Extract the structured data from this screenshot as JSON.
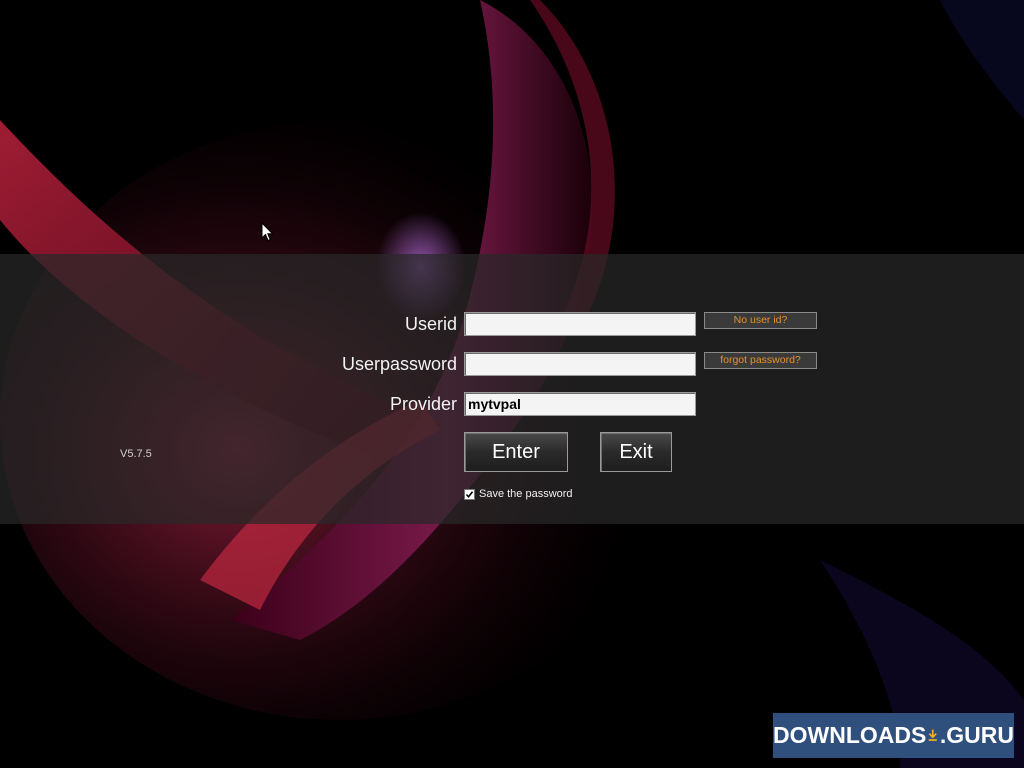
{
  "form": {
    "userid_label": "Userid",
    "userid_value": "",
    "password_label": "Userpassword",
    "password_value": "",
    "provider_label": "Provider",
    "provider_value": "mytvpal",
    "no_user_id_link": "No user id?",
    "forgot_password_link": "forgot password?",
    "enter_label": "Enter",
    "exit_label": "Exit",
    "save_password_label": "Save the password",
    "save_password_checked": true
  },
  "version": "V5.7.5",
  "watermark": {
    "left_text": "DOWNLOADS",
    "right_text": ".GURU",
    "icon": "download-arrow-icon"
  },
  "colors": {
    "link_text": "#e8902a",
    "band": "#282828",
    "watermark_bg": "#2f4f7d"
  }
}
